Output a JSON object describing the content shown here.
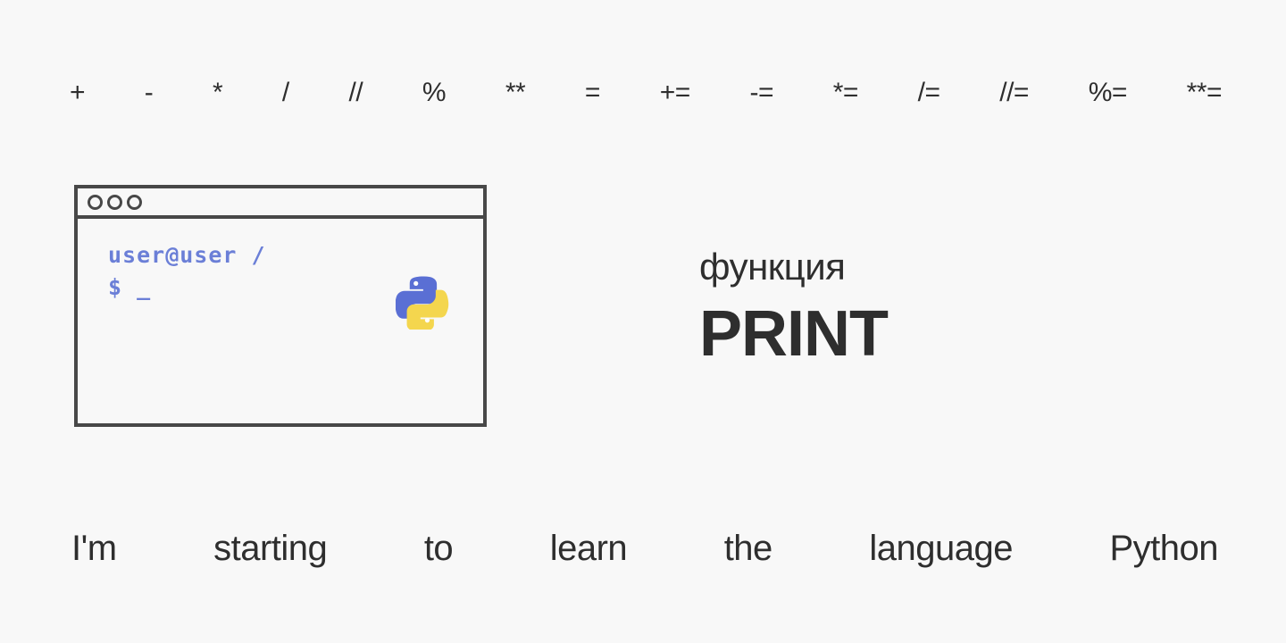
{
  "page": {
    "background_color": "#f8f8f8",
    "text_color": "#2e2e2e"
  },
  "operators": {
    "items": [
      {
        "label": "+",
        "name": "operator-plus"
      },
      {
        "label": "-",
        "name": "operator-minus"
      },
      {
        "label": "*",
        "name": "operator-multiply"
      },
      {
        "label": "/",
        "name": "operator-divide"
      },
      {
        "label": "//",
        "name": "operator-floor-divide"
      },
      {
        "label": "%",
        "name": "operator-modulo"
      },
      {
        "label": "**",
        "name": "operator-power"
      },
      {
        "label": "=",
        "name": "operator-assign"
      },
      {
        "label": "+=",
        "name": "operator-plus-assign"
      },
      {
        "label": "-=",
        "name": "operator-minus-assign"
      },
      {
        "label": "*=",
        "name": "operator-multiply-assign"
      },
      {
        "label": "/=",
        "name": "operator-divide-assign"
      },
      {
        "label": "//=",
        "name": "operator-floor-divide-assign"
      },
      {
        "label": "%=",
        "name": "operator-modulo-assign"
      },
      {
        "label": "**=",
        "name": "operator-power-assign"
      }
    ]
  },
  "terminal": {
    "border_color": "#484848",
    "prompt_color": "#6b7fd7",
    "dot_count": 3,
    "prompt_line1": "user@user /",
    "prompt_line2": "$ _",
    "logo": {
      "name": "python-logo",
      "blue": "#5a6fd4",
      "yellow": "#f4d64e"
    }
  },
  "heading": {
    "subtitle": "функция",
    "title": "PRINT"
  },
  "caption": {
    "words": [
      "I'm",
      "starting",
      "to",
      "learn",
      "the",
      "language",
      "Python"
    ]
  }
}
